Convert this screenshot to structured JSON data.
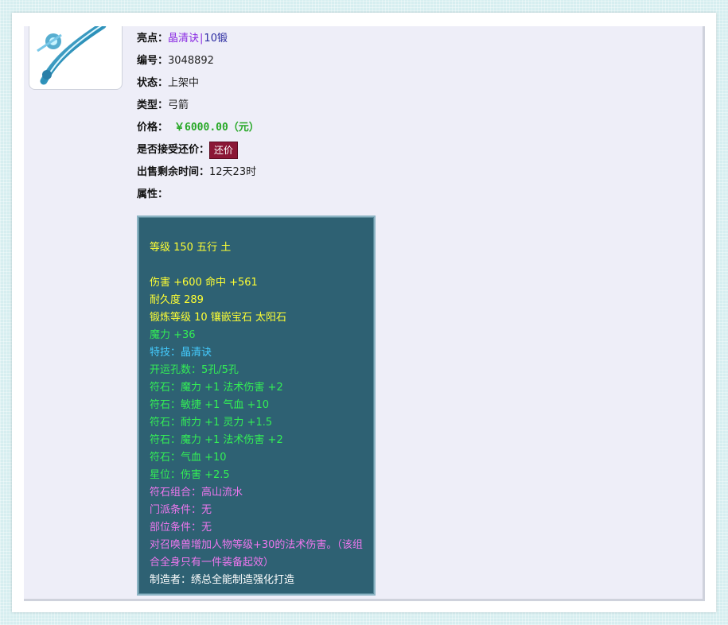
{
  "item": {
    "highlight_label": "亮点：",
    "highlight_value_1": "晶清诀",
    "highlight_sep": "|",
    "highlight_value_2": "10锻",
    "number_label": "编号：",
    "number_value": "3048892",
    "status_label": "状态：",
    "status_value": "上架中",
    "type_label": "类型：",
    "type_value": "弓箭",
    "price_label": "价格：",
    "price_value": "￥6000.00（元）",
    "counter_label": "是否接受还价：",
    "counter_button": "还价",
    "time_label": "出售剩余时间：",
    "time_value": "12天23时",
    "attr_label": "属性："
  },
  "attributes": {
    "level_line": "等级 150 五行 土",
    "damage_line": "伤害 +600 命中 +561",
    "durability_line": "耐久度 289",
    "forge_line": "锻炼等级 10 镶嵌宝石 太阳石",
    "magic_line": "魔力 +36",
    "skill_line": "特技：晶清诀",
    "holes_line": "开运孔数：5孔/5孔",
    "rune_1": "符石：魔力 +1 法术伤害 +2",
    "rune_2": "符石：敏捷 +1 气血 +10",
    "rune_3": "符石：耐力 +1 灵力 +1.5",
    "rune_4": "符石：魔力 +1 法术伤害 +2",
    "rune_5": "符石：气血 +10",
    "star_line": "星位：伤害 +2.5",
    "combo_line": "符石组合：高山流水",
    "sect_line": "门派条件：无",
    "slot_line": "部位条件：无",
    "effect_line": "对召唤兽增加人物等级+30的法术伤害。（该组合全身只有一件装备起效）",
    "maker_line": "制造者：绣总全能制造强化打造"
  },
  "colors": {
    "panel_bg": "#eeeef8",
    "attr_bg": "#2e6173",
    "yellow": "#ffff33",
    "green": "#33ee55",
    "cyan": "#44ccff",
    "pink": "#ee77ee",
    "price": "#27a827",
    "button": "#8b1736"
  },
  "icons": {
    "item_image": "bow-weapon-icon"
  }
}
